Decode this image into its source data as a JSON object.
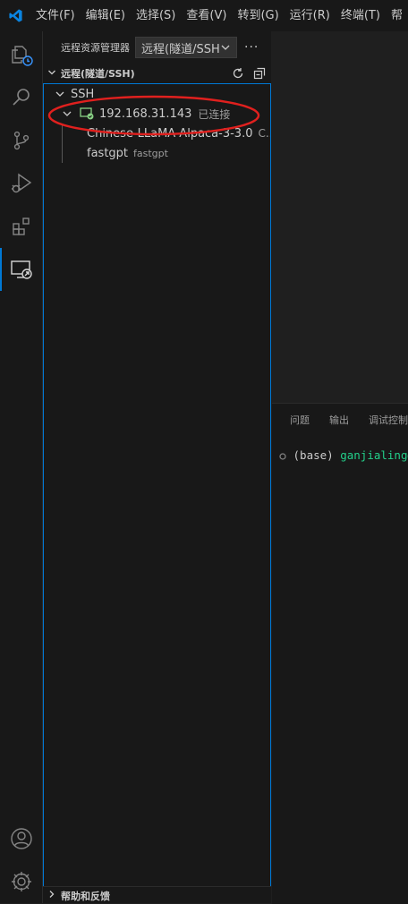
{
  "menu": {
    "items": [
      "文件(F)",
      "编辑(E)",
      "选择(S)",
      "查看(V)",
      "转到(G)",
      "运行(R)",
      "终端(T)",
      "帮"
    ]
  },
  "activity": {
    "icons": [
      "explorer-icon",
      "search-icon",
      "source-control-icon",
      "run-debug-icon",
      "extensions-icon",
      "remote-explorer-icon",
      "account-icon",
      "settings-gear-icon"
    ]
  },
  "sidebar": {
    "title": "远程资源管理器",
    "dropdown_value": "远程(隧道/SSH",
    "section_title": "远程(隧道/SSH)",
    "tree": {
      "group_label": "SSH",
      "host": "192.168.31.143",
      "host_status": "已连接",
      "folders": [
        {
          "name": "Chinese-LLaMA-Alpaca-3-3.0",
          "detail": "C..."
        },
        {
          "name": "fastgpt",
          "detail": "fastgpt"
        }
      ]
    },
    "help_section": "帮助和反馈"
  },
  "panel": {
    "tabs": [
      "问题",
      "输出",
      "调试控制"
    ],
    "terminal": {
      "prefix": "(base)",
      "user": "ganjialing@g"
    }
  },
  "annotation": {
    "color": "#e0201e"
  }
}
